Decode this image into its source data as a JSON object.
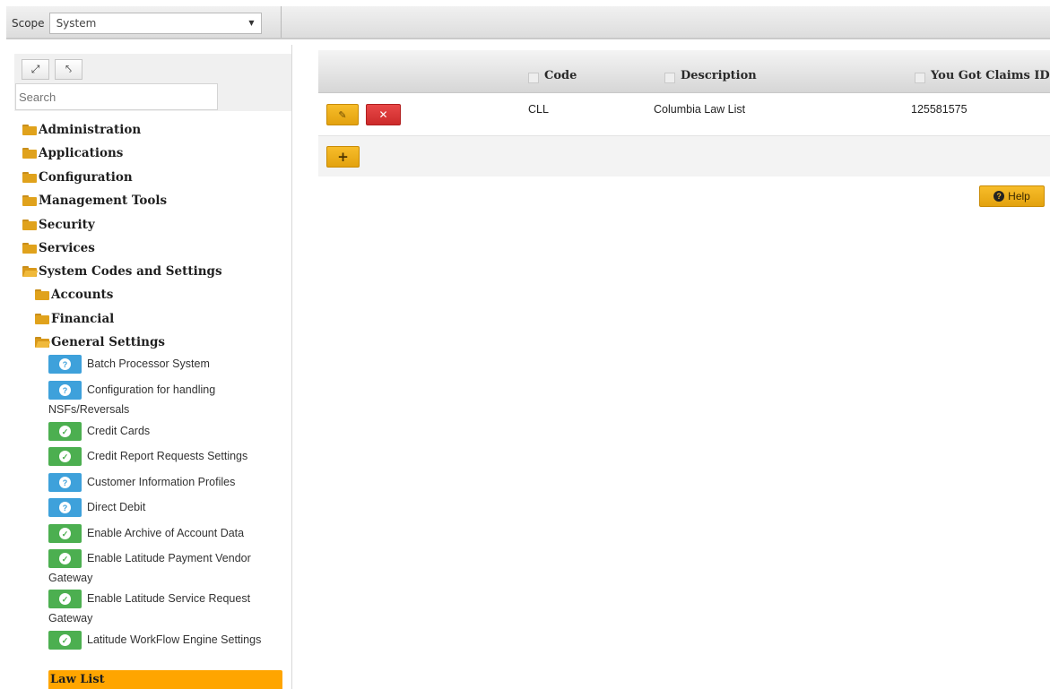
{
  "scope": {
    "label": "Scope",
    "selected": "System"
  },
  "tree_tools": {
    "expand_icon": "expand-icon",
    "collapse_icon": "collapse-icon",
    "search_placeholder": "Search"
  },
  "tree": {
    "folders": [
      {
        "label": "Administration"
      },
      {
        "label": "Applications"
      },
      {
        "label": "Configuration"
      },
      {
        "label": "Management Tools"
      },
      {
        "label": "Security"
      },
      {
        "label": "Services"
      },
      {
        "label": "System Codes and Settings"
      },
      {
        "label": "Accounts"
      },
      {
        "label": "Financial"
      },
      {
        "label": "General Settings"
      }
    ],
    "settings": [
      {
        "label": "Batch Processor System",
        "status": "info"
      },
      {
        "label": "Configuration for handling NSFs/Reversals",
        "status": "info"
      },
      {
        "label": "Credit Cards",
        "status": "ok"
      },
      {
        "label": "Credit Report Requests Settings",
        "status": "ok"
      },
      {
        "label": "Customer Information Profiles",
        "status": "info"
      },
      {
        "label": "Direct Debit",
        "status": "info"
      },
      {
        "label": "Enable Archive of Account Data",
        "status": "ok"
      },
      {
        "label": "Enable Latitude Payment Vendor Gateway",
        "status": "ok"
      },
      {
        "label": "Enable Latitude Service Request Gateway",
        "status": "ok"
      },
      {
        "label": "Latitude WorkFlow Engine Settings",
        "status": "ok"
      }
    ],
    "selected_item": "Law List"
  },
  "grid": {
    "columns": [
      "Code",
      "Description",
      "You Got Claims ID"
    ],
    "rows": [
      {
        "code": "CLL",
        "description": "Columbia Law List",
        "claims_id": "125581575"
      }
    ],
    "add_label": "+"
  },
  "help": {
    "label": "Help"
  },
  "colors": {
    "accent": "#ffa500",
    "button_yellow": "#f2b324",
    "delete_red": "#d93434",
    "info_blue": "#3ea1db",
    "ok_green": "#4caf50"
  }
}
